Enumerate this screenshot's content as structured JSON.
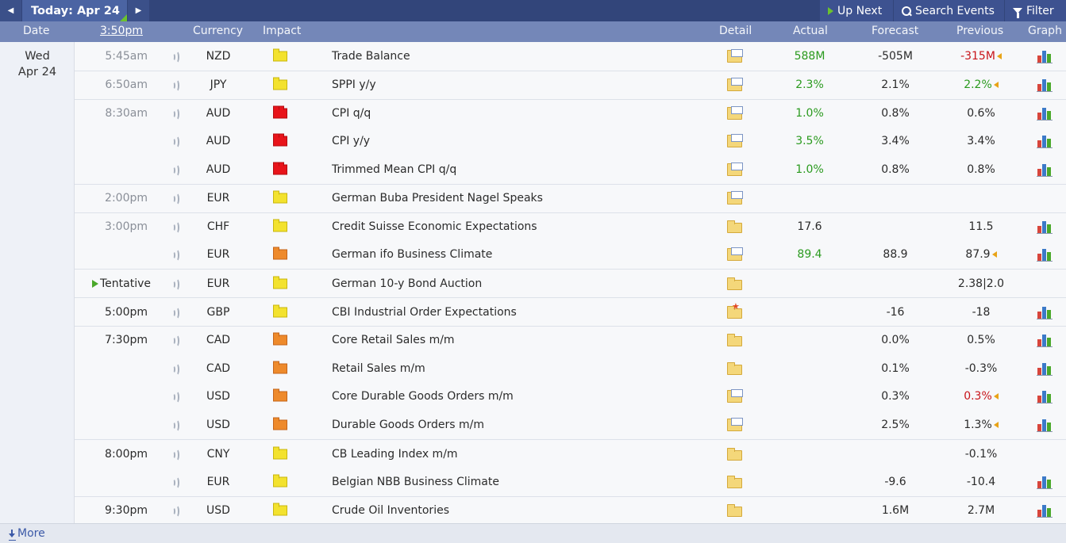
{
  "toolbar": {
    "today_label": "Today: Apr 24",
    "up_next_label": "Up Next",
    "search_label": "Search Events",
    "filter_label": "Filter"
  },
  "columns": {
    "date": "Date",
    "time": "3:50pm",
    "currency": "Currency",
    "impact": "Impact",
    "detail": "Detail",
    "actual": "Actual",
    "forecast": "Forecast",
    "previous": "Previous",
    "graph": "Graph"
  },
  "day": {
    "weekday": "Wed",
    "date": "Apr 24"
  },
  "events": [
    {
      "time": "5:45am",
      "currency": "NZD",
      "impact": "yellow",
      "event": "Trade Balance",
      "detail_icon": "folder-doc-icon",
      "actual": "588M",
      "actual_color": "green",
      "forecast": "-505M",
      "previous": "-315M",
      "previous_color": "red",
      "previous_revised": true,
      "graph": true
    },
    {
      "time": "6:50am",
      "currency": "JPY",
      "impact": "yellow",
      "event": "SPPI y/y",
      "detail_icon": "folder-doc-icon",
      "actual": "2.3%",
      "actual_color": "green",
      "forecast": "2.1%",
      "previous": "2.2%",
      "previous_color": "green",
      "previous_revised": true,
      "graph": true
    },
    {
      "time": "8:30am",
      "currency": "AUD",
      "impact": "red",
      "event": "CPI q/q",
      "detail_icon": "folder-doc-icon",
      "actual": "1.0%",
      "actual_color": "green",
      "forecast": "0.8%",
      "previous": "0.6%",
      "graph": true
    },
    {
      "time": "",
      "currency": "AUD",
      "impact": "red",
      "event": "CPI y/y",
      "detail_icon": "folder-doc-icon",
      "actual": "3.5%",
      "actual_color": "green",
      "forecast": "3.4%",
      "previous": "3.4%",
      "graph": true
    },
    {
      "time": "",
      "currency": "AUD",
      "impact": "red",
      "event": "Trimmed Mean CPI q/q",
      "detail_icon": "folder-doc-icon",
      "actual": "1.0%",
      "actual_color": "green",
      "forecast": "0.8%",
      "previous": "0.8%",
      "graph": true
    },
    {
      "time": "2:00pm",
      "currency": "EUR",
      "impact": "yellow",
      "event": "German Buba President Nagel Speaks",
      "detail_icon": "folder-doc-icon",
      "actual": "",
      "forecast": "",
      "previous": "",
      "graph": false
    },
    {
      "time": "3:00pm",
      "currency": "CHF",
      "impact": "yellow",
      "event": "Credit Suisse Economic Expectations",
      "detail_icon": "folder-icon",
      "actual": "17.6",
      "actual_color": "plain",
      "forecast": "",
      "previous": "11.5",
      "graph": true
    },
    {
      "time": "",
      "currency": "EUR",
      "impact": "orange",
      "event": "German ifo Business Climate",
      "detail_icon": "folder-doc-icon",
      "actual": "89.4",
      "actual_color": "green",
      "forecast": "88.9",
      "previous": "87.9",
      "previous_revised": true,
      "graph": true
    },
    {
      "time": "Tentative",
      "currency": "EUR",
      "impact": "yellow",
      "event": "German 10-y Bond Auction",
      "detail_icon": "folder-icon",
      "actual": "",
      "forecast": "",
      "previous": "2.38|2.0",
      "graph": false
    },
    {
      "time": "5:00pm",
      "currency": "GBP",
      "impact": "yellow",
      "event": "CBI Industrial Order Expectations",
      "detail_icon": "folder-star-icon",
      "actual": "",
      "forecast": "-16",
      "previous": "-18",
      "graph": true
    },
    {
      "time": "7:30pm",
      "currency": "CAD",
      "impact": "orange",
      "event": "Core Retail Sales m/m",
      "detail_icon": "folder-icon",
      "actual": "",
      "forecast": "0.0%",
      "previous": "0.5%",
      "graph": true
    },
    {
      "time": "",
      "currency": "CAD",
      "impact": "orange",
      "event": "Retail Sales m/m",
      "detail_icon": "folder-icon",
      "actual": "",
      "forecast": "0.1%",
      "previous": "-0.3%",
      "graph": true
    },
    {
      "time": "",
      "currency": "USD",
      "impact": "orange",
      "event": "Core Durable Goods Orders m/m",
      "detail_icon": "folder-doc-icon",
      "actual": "",
      "forecast": "0.3%",
      "previous": "0.3%",
      "previous_color": "red",
      "previous_revised": true,
      "graph": true
    },
    {
      "time": "",
      "currency": "USD",
      "impact": "orange",
      "event": "Durable Goods Orders m/m",
      "detail_icon": "folder-doc-icon",
      "actual": "",
      "forecast": "2.5%",
      "previous": "1.3%",
      "previous_revised": true,
      "graph": true
    },
    {
      "time": "8:00pm",
      "currency": "CNY",
      "impact": "yellow",
      "event": "CB Leading Index m/m",
      "detail_icon": "folder-icon",
      "actual": "",
      "forecast": "",
      "previous": "-0.1%",
      "graph": false
    },
    {
      "time": "",
      "currency": "EUR",
      "impact": "yellow",
      "event": "Belgian NBB Business Climate",
      "detail_icon": "folder-icon",
      "actual": "",
      "forecast": "-9.6",
      "previous": "-10.4",
      "graph": true
    },
    {
      "time": "9:30pm",
      "currency": "USD",
      "impact": "yellow",
      "event": "Crude Oil Inventories",
      "detail_icon": "folder-icon",
      "actual": "",
      "forecast": "1.6M",
      "previous": "2.7M",
      "graph": true
    }
  ],
  "footer": {
    "more_label": "More"
  },
  "colors": {
    "topbar": "#32457a",
    "header": "#7487b8",
    "green": "#2a9a1e",
    "red": "#c8141a",
    "impact_high": "#e8141a",
    "impact_medium": "#ee8a2b",
    "impact_low": "#f3e22e"
  }
}
